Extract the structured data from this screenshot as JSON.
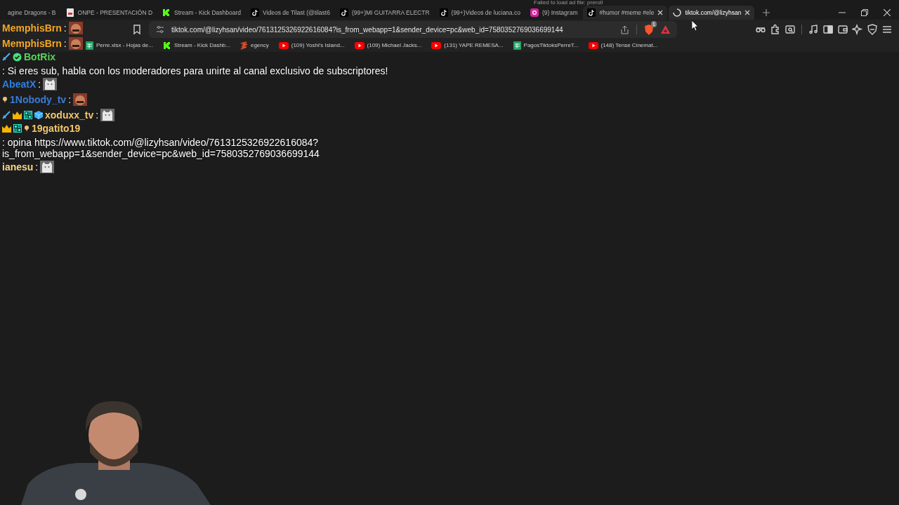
{
  "tabs": [
    {
      "title": "agine Dragons - B",
      "kind": "plain",
      "selected": false,
      "closable": false,
      "loading": false
    },
    {
      "title": "ONPE - PRESENTACIÓN D",
      "kind": "pdf",
      "selected": false,
      "closable": false,
      "loading": false
    },
    {
      "title": "Stream - Kick Dashboard",
      "kind": "kick",
      "selected": false,
      "closable": false,
      "loading": false
    },
    {
      "title": "Videos de Tilast (@tilast6",
      "kind": "tiktok",
      "selected": false,
      "closable": false,
      "loading": false
    },
    {
      "title": "(99+)MI GUITARRA ELECTR",
      "kind": "tiktok",
      "selected": false,
      "closable": false,
      "loading": false
    },
    {
      "title": "(99+)Videos de luciana.co",
      "kind": "tiktok",
      "selected": false,
      "closable": false,
      "loading": false
    },
    {
      "title": "(9) Instagram",
      "kind": "instagram",
      "selected": false,
      "closable": false,
      "loading": false
    },
    {
      "title": "#humor #meme #ele",
      "kind": "tiktok",
      "selected": false,
      "closable": true,
      "loading": false
    },
    {
      "title": "tiktok.com/@lizyhsan",
      "selected": true,
      "closable": true,
      "loading": true
    }
  ],
  "ad_notice": "Failed to load ad file: preroll",
  "address": {
    "url": "tiktok.com/@lizyhsan/video/7613125326922616084?is_from_webapp=1&sender_device=pc&web_id=7580352769036699144",
    "shield_count": "1"
  },
  "bookmarks": [
    {
      "label": "Perre.xlsx - Hojas de...",
      "kind": "sheets"
    },
    {
      "label": "Stream - Kick Dashb...",
      "kind": "kick"
    },
    {
      "label": "egency",
      "kind": "bolt"
    },
    {
      "label": "(109) Yoshi's Island...",
      "kind": "youtube"
    },
    {
      "label": "(109) Michael Jacks...",
      "kind": "youtube"
    },
    {
      "label": "(131) YAPE REMESA...",
      "kind": "youtube"
    },
    {
      "label": "PagosTiktoksPerreT...",
      "kind": "sheets"
    },
    {
      "label": "(148) Tense Cinemat...",
      "kind": "youtube"
    }
  ],
  "chat": [
    {
      "user": "MemphisBrn",
      "color": "#f5a623",
      "text": ":",
      "emote": {
        "kind": "face"
      }
    },
    {
      "user": "MemphisBrn",
      "color": "#f5a623",
      "text": ":",
      "emote": {
        "kind": "face"
      }
    },
    {
      "user": "BotRix",
      "color": "#57d45a",
      "badges": [
        {
          "kind": "sword"
        },
        {
          "kind": "verified"
        }
      ],
      "text": ": Si eres sub, habla con los moderadores para unirte al canal exclusivo de subscriptores!"
    },
    {
      "user": "AbeatX",
      "color": "#2f7fe0",
      "text": ":",
      "emote": {
        "kind": "cat"
      }
    },
    {
      "user": "1Nobody_tv",
      "color": "#3a7bd5",
      "badges": [
        {
          "kind": "pin"
        }
      ],
      "text": ":",
      "emote": {
        "kind": "face"
      }
    },
    {
      "user": "xoduxx_tv",
      "color": "#f2c66d",
      "badges": [
        {
          "kind": "sword"
        },
        {
          "kind": "crown"
        },
        {
          "kind": "grid"
        },
        {
          "kind": "cube"
        }
      ],
      "text": ":",
      "emote": {
        "kind": "cat"
      }
    },
    {
      "user": "19gatito19",
      "color": "#f2c66d",
      "badges": [
        {
          "kind": "crown"
        },
        {
          "kind": "grid"
        },
        {
          "kind": "pin"
        }
      ],
      "text": ": opina https://www.tiktok.com/@lizyhsan/video/7613125326922616084?is_from_webapp=1&sender_device=pc&web_id=7580352769036699144"
    },
    {
      "user": "ianesu",
      "color": "#f5d58a",
      "text": ":",
      "emote": {
        "kind": "cat"
      }
    }
  ]
}
